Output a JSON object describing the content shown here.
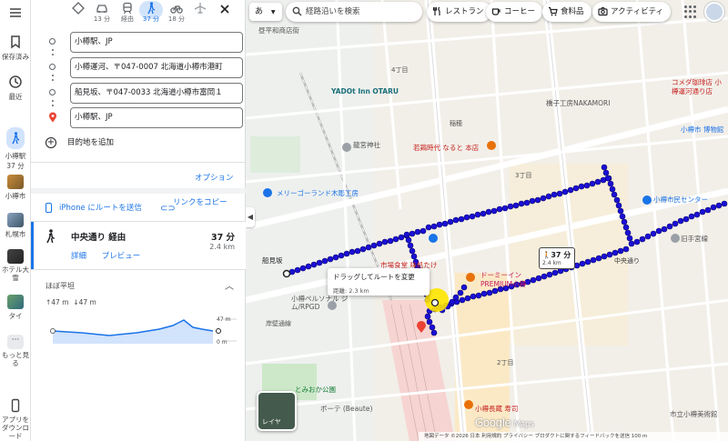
{
  "rail": {
    "saved": "保存済み",
    "recent": "最近",
    "current_place": "小樽駅",
    "current_time": "37 分",
    "recents": [
      {
        "label": "小樽市"
      },
      {
        "label": "札幌市"
      },
      {
        "label": "ホテル大雪"
      },
      {
        "label": "タイ"
      }
    ],
    "more": "もっと見る",
    "app_download": "アプリをダウンロード"
  },
  "modes": [
    {
      "name": "best",
      "label": ""
    },
    {
      "name": "car",
      "label": "13 分"
    },
    {
      "name": "transit",
      "label": "経由"
    },
    {
      "name": "walk",
      "label": "37 分"
    },
    {
      "name": "bike",
      "label": "18 分"
    },
    {
      "name": "flight",
      "label": ""
    }
  ],
  "stops": [
    "小樽駅、JP",
    "小樽運河、〒047-0007 北海道小樽市港町",
    "船見坂、〒047-0033 北海道小樽市富岡１",
    "小樽駅、JP"
  ],
  "add_destination": "目的地を追加",
  "options": "オプション",
  "send_iphone": "iPhone にルートを送信",
  "copy_link": "リンクをコピー",
  "route": {
    "title": "中央通り 経由",
    "time": "37 分",
    "distance": "2.4 km",
    "details": "詳細",
    "preview": "プレビュー"
  },
  "elevation": {
    "title": "ほぼ平坦",
    "up": "↑47 m",
    "down": "↓47 m",
    "max_label": "47 m",
    "min_label": "0 m"
  },
  "map": {
    "lang": "あ",
    "search_placeholder": "経路沿いを検索",
    "chips": [
      "レストラン",
      "コーヒー",
      "食料品",
      "アクティビティ"
    ],
    "labels": {
      "funamizaka": "船見坂",
      "tooltip_title": "ドラッグしてルートを変更",
      "tooltip_sub": "距離: 2.3 km",
      "bubble_time": "37 分",
      "bubble_dist": "2.4 km",
      "layer": "レイヤ",
      "chome4": "4丁目",
      "chome3": "3丁目",
      "chome2": "2丁目",
      "inaho": "稲穂",
      "chuodori": "中央通り",
      "ryugu": "龍宮神社",
      "yadot": "YADOt Inn OTARU",
      "wakadori": "若鶏時代 なると 本店",
      "merry": "メリーゴーランド木彫工房",
      "shokudo": "市場食堂 味処たけ",
      "dormy": "ドーミーイン PREMIUM小樽",
      "persona": "小樽ペルソナル ジム/RPGD",
      "ganpeki": "岸壁通線",
      "tomioka": "とみおか公園",
      "beaute": "ボーテ (Beaute)",
      "shimin": "小樽市民センター",
      "kyu": "旧手宮線",
      "komeda": "コメダ珈琲店 小樽運河通り店",
      "kinoko": "橋子工房NAKAMORI",
      "marche": "小樽長蔵 寿司",
      "bijutsu": "市立小樽美術館",
      "museum": "小樽市 博物館",
      "kaimono": "昼平和商店街"
    },
    "footer": "地図データ ©2026   日本   利用規約   プライバシー   プロダクトに関するフィードバックを送信   100 m"
  },
  "colors": {
    "route": "#1a0fd6",
    "accent": "#1a73e8",
    "map_bg": "#f2efe9",
    "elevation_fill": "#d2e3fc"
  }
}
